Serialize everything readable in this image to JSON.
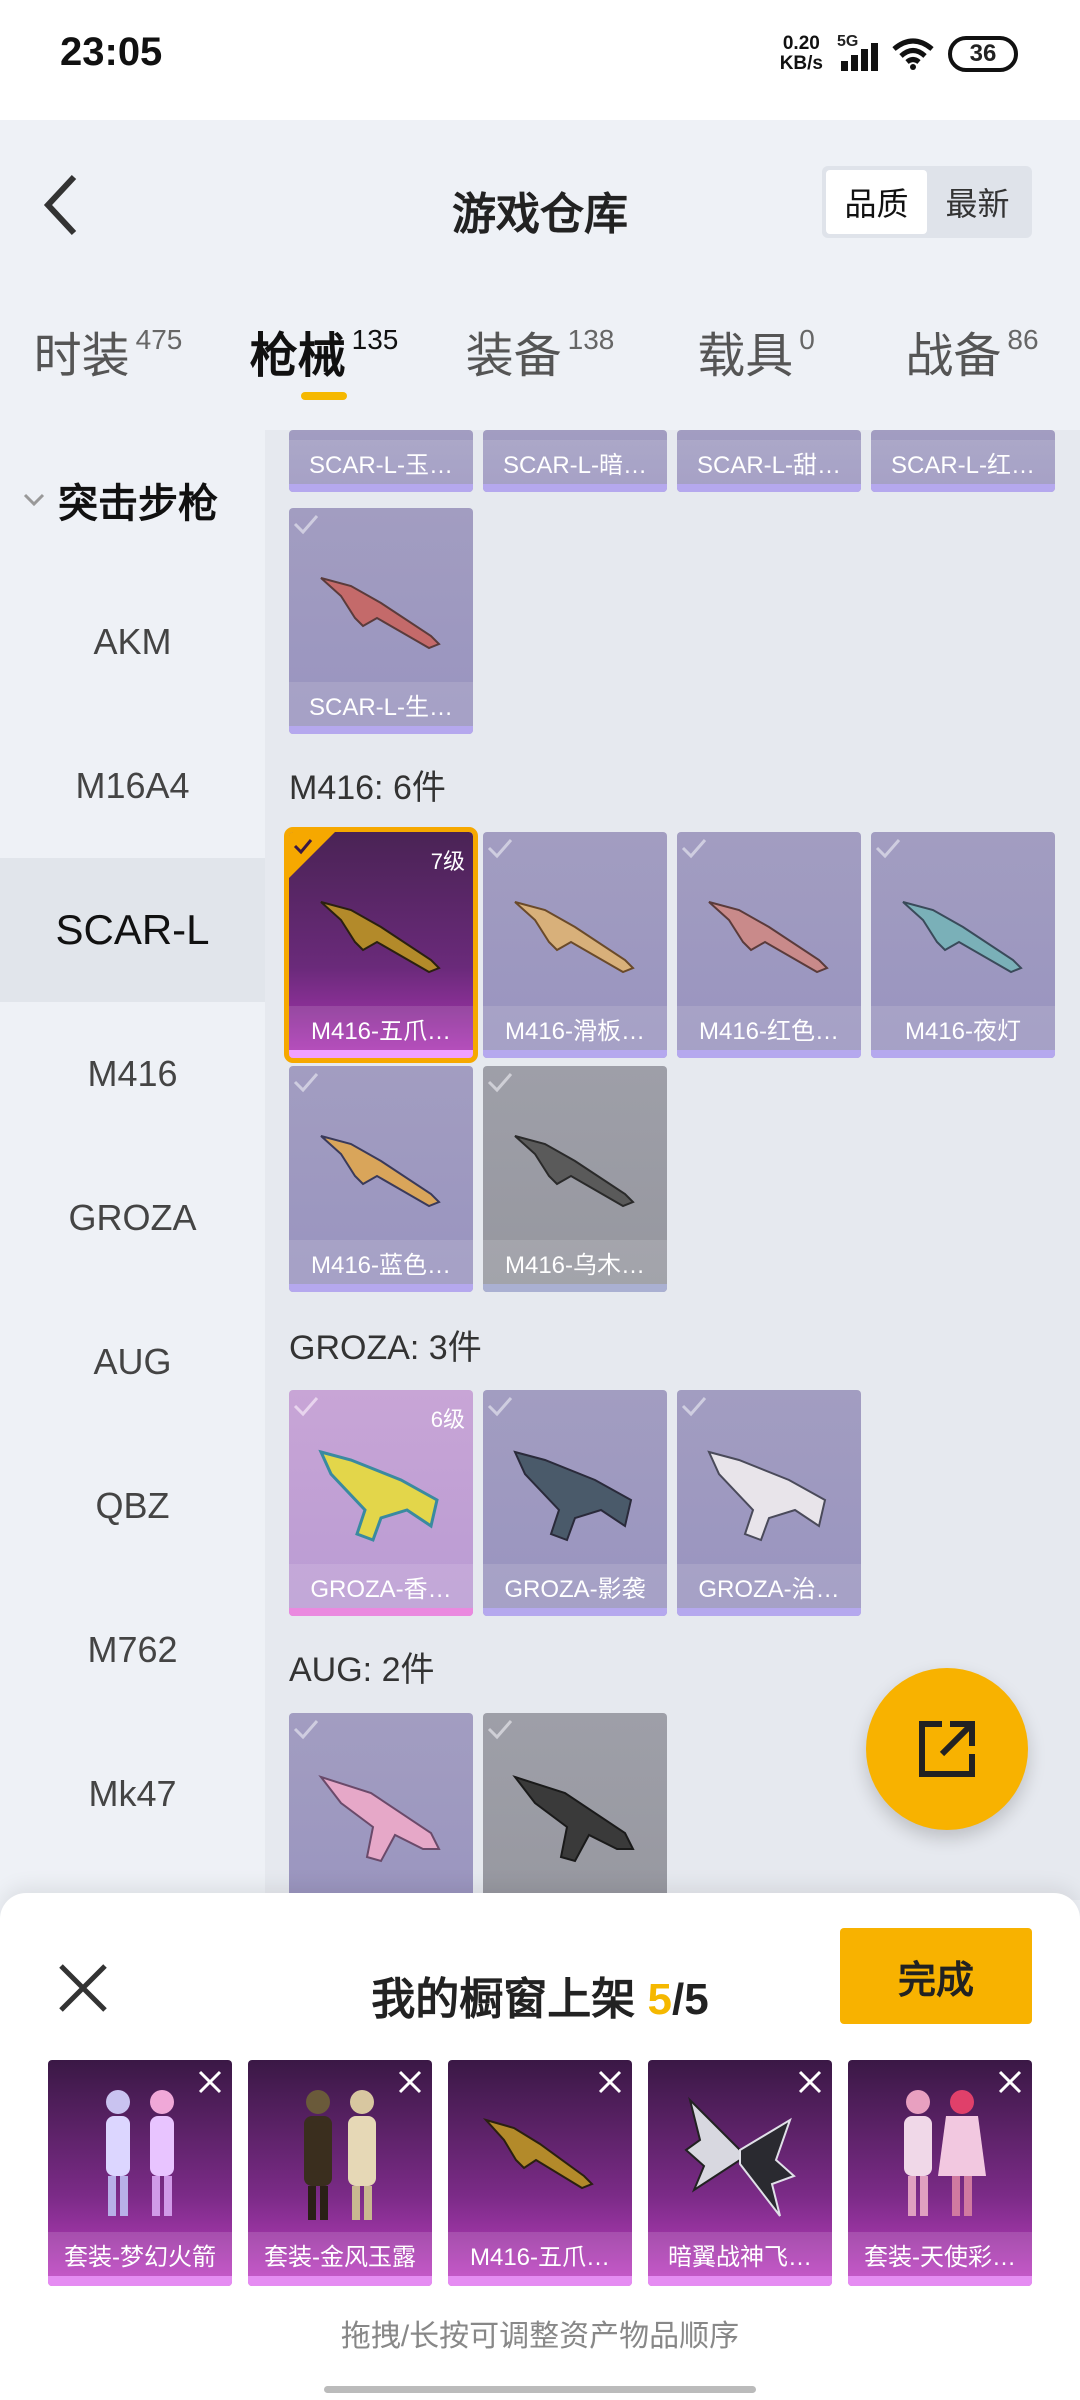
{
  "status_bar": {
    "time": "23:05",
    "net_speed_value": "0.20",
    "net_speed_unit": "KB/s",
    "network_type": "5G",
    "battery": "36"
  },
  "header": {
    "title": "游戏仓库",
    "sort_options": [
      "品质",
      "最新"
    ],
    "active_sort": "品质"
  },
  "tabs": [
    {
      "label": "时装",
      "count": "475"
    },
    {
      "label": "枪械",
      "count": "135",
      "active": true
    },
    {
      "label": "装备",
      "count": "138"
    },
    {
      "label": "载具",
      "count": "0"
    },
    {
      "label": "战备",
      "count": "86"
    }
  ],
  "sidebar": {
    "group_label": "突击步枪",
    "items": [
      "AKM",
      "M16A4",
      "SCAR-L",
      "M416",
      "GROZA",
      "AUG",
      "QBZ",
      "M762",
      "Mk47"
    ],
    "active_item": "SCAR-L"
  },
  "main": {
    "scar_top_row": [
      "SCAR-L-玉…",
      "SCAR-L-暗…",
      "SCAR-L-甜…",
      "SCAR-L-红…"
    ],
    "scar_extra": "SCAR-L-生…",
    "m416_section": "M416: 6件",
    "m416_items": [
      {
        "name": "M416-五爪…",
        "level": "7级",
        "selected": true
      },
      {
        "name": "M416-滑板…"
      },
      {
        "name": "M416-红色…"
      },
      {
        "name": "M416-夜灯"
      },
      {
        "name": "M416-蓝色…"
      },
      {
        "name": "M416-乌木…"
      }
    ],
    "groza_section": "GROZA: 3件",
    "groza_items": [
      {
        "name": "GROZA-香…",
        "level": "6级"
      },
      {
        "name": "GROZA-影袭"
      },
      {
        "name": "GROZA-治…"
      }
    ],
    "aug_section": "AUG: 2件"
  },
  "sheet": {
    "title_prefix": "我的橱窗上架",
    "count_current": "5",
    "count_total": "/5",
    "done_label": "完成",
    "items": [
      "套装-梦幻火箭",
      "套装-金风玉露",
      "M416-五爪…",
      "暗翼战神飞…",
      "套装-天使彩…"
    ],
    "hint": "拖拽/长按可调整资产物品顺序"
  }
}
